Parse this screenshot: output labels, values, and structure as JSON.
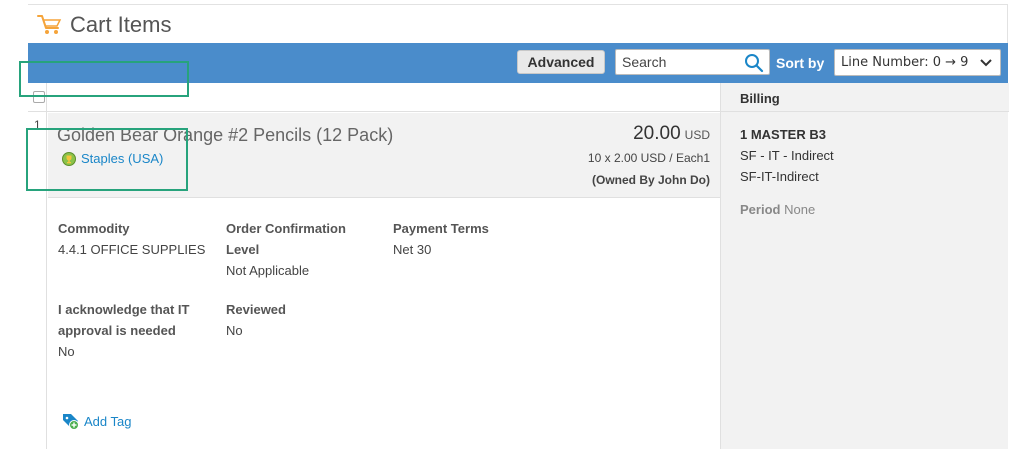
{
  "section": {
    "title": "Cart Items",
    "icon": "cart-icon"
  },
  "toolbar": {
    "advanced_label": "Advanced",
    "search_placeholder": "Search",
    "sortby_label": "Sort by",
    "sort_value": "Line Number: 0 → 9",
    "bar_color": "#4a8ccb"
  },
  "line": {
    "number": "1",
    "item_name": "Golden Bear Orange #2 Pencils (12 Pack)",
    "supplier": "Staples (USA)",
    "price": "20.00",
    "currency": "USD",
    "price_detail": "10 x 2.00 USD / Each1",
    "owned_by": "(Owned By John Do)",
    "fields": {
      "commodity_label": "Commodity",
      "commodity_value": "4.4.1 OFFICE SUPPLIES",
      "order_conf_label_1": "Order Confirmation",
      "order_conf_label_2": "Level",
      "order_conf_value": "Not Applicable",
      "payment_terms_label": "Payment Terms",
      "payment_terms_value": "Net 30",
      "ack_label_1": "I acknowledge that IT",
      "ack_label_2": "approval is needed",
      "ack_value": "No",
      "reviewed_label": "Reviewed",
      "reviewed_value": "No"
    },
    "add_tag_label": "Add Tag"
  },
  "billing": {
    "header": "Billing",
    "line1": "1 MASTER B3",
    "line2": "SF - IT - Indirect",
    "line3": "SF-IT-Indirect",
    "period_label": "Period",
    "period_value": "None"
  },
  "colors": {
    "link": "#1a86c8",
    "highlight": "#27a37c",
    "toolbar": "#4a8ccb"
  }
}
